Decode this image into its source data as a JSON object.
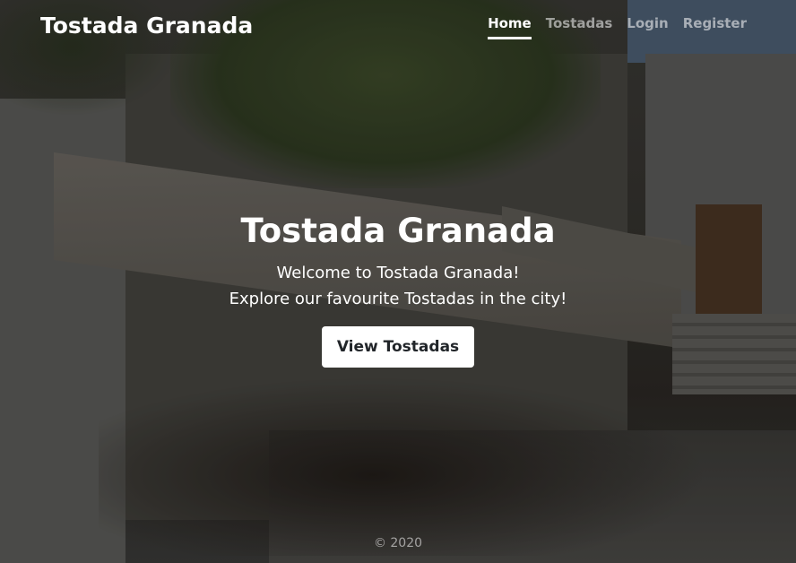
{
  "navbar": {
    "brand": "Tostada Granada",
    "links": [
      {
        "label": "Home",
        "active": true
      },
      {
        "label": "Tostadas",
        "active": false
      },
      {
        "label": "Login",
        "active": false
      },
      {
        "label": "Register",
        "active": false
      }
    ]
  },
  "hero": {
    "title": "Tostada Granada",
    "lead_line1": "Welcome to Tostada Granada!",
    "lead_line2": "Explore our favourite Tostadas in the city!",
    "button_label": "View Tostadas"
  },
  "footer": {
    "text": "© 2020"
  },
  "colors": {
    "button_bg": "#ffffff",
    "button_text": "#212529",
    "nav_active": "#ffffff",
    "nav_inactive": "rgba(255,255,255,0.55)"
  }
}
